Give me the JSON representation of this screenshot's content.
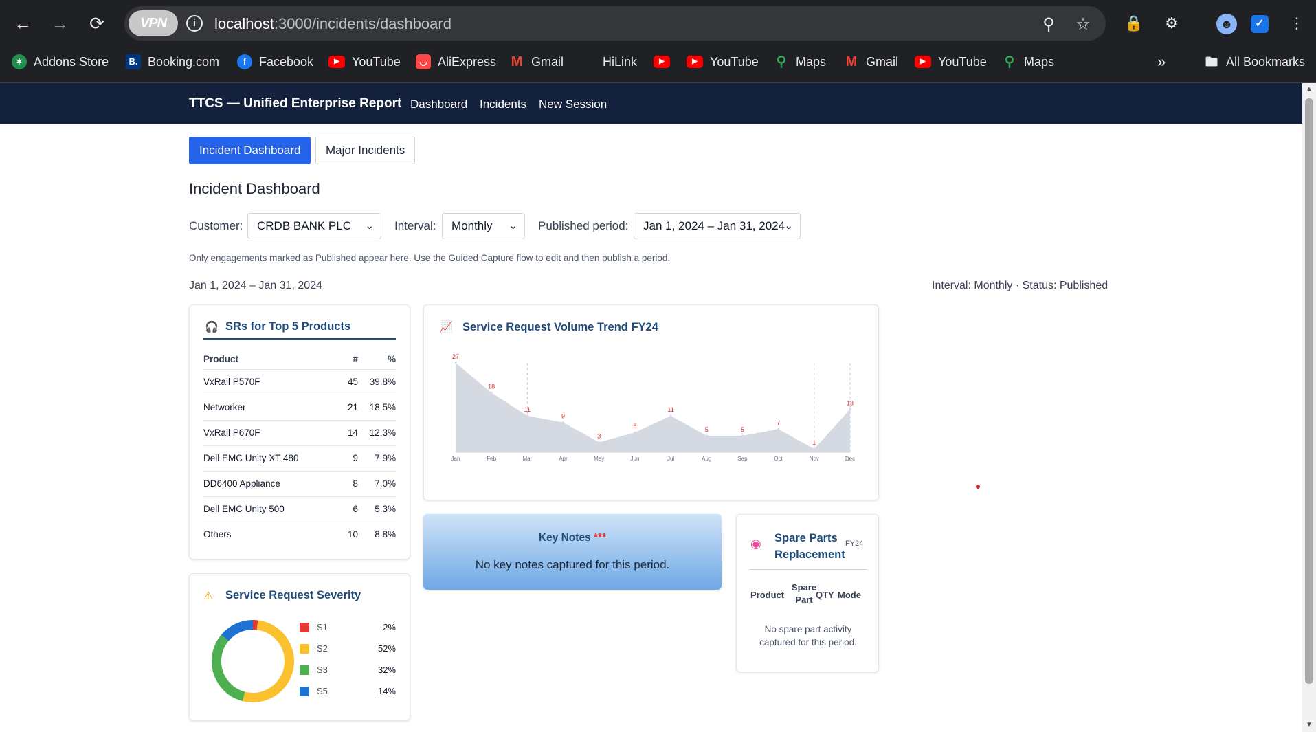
{
  "browser": {
    "url_host": "localhost",
    "url_path": ":3000/incidents/dashboard",
    "vpn_label": "VPN",
    "bookmarks": [
      {
        "label": "Addons Store",
        "icon": "addons-store-icon"
      },
      {
        "label": "Booking.com",
        "icon": "booking-icon"
      },
      {
        "label": "Facebook",
        "icon": "facebook-icon"
      },
      {
        "label": "YouTube",
        "icon": "youtube-icon"
      },
      {
        "label": "AliExpress",
        "icon": "aliexpress-icon"
      },
      {
        "label": "Gmail",
        "icon": "gmail-icon"
      },
      {
        "label": "HiLink",
        "icon": "hilink-icon"
      },
      {
        "label": "",
        "icon": "youtube-icon"
      },
      {
        "label": "YouTube",
        "icon": "youtube-icon"
      },
      {
        "label": "Maps",
        "icon": "maps-icon"
      },
      {
        "label": "Gmail",
        "icon": "gmail-icon"
      },
      {
        "label": "YouTube",
        "icon": "youtube-icon"
      },
      {
        "label": "Maps",
        "icon": "maps-icon"
      }
    ],
    "all_bookmarks": "All Bookmarks"
  },
  "app": {
    "title": "TTCS — Unified Enterprise Report",
    "nav": [
      "Dashboard",
      "Incidents",
      "New Session"
    ]
  },
  "tabs": [
    "Incident Dashboard",
    "Major Incidents"
  ],
  "heading": "Incident Dashboard",
  "filters": {
    "customer_label": "Customer:",
    "customer_value": "CRDB BANK PLC",
    "interval_label": "Interval:",
    "interval_value": "Monthly",
    "period_label": "Published period:",
    "period_value": "Jan 1, 2024 – Jan 31, 2024"
  },
  "hint": "Only engagements marked as Published appear here. Use the Guided Capture flow to edit and then publish a period.",
  "period_display": "Jan 1, 2024 – Jan 31, 2024",
  "status_display": "Interval: Monthly · Status: Published",
  "top_products": {
    "title": "SRs for Top 5 Products",
    "headers": [
      "Product",
      "#",
      "%"
    ],
    "rows": [
      [
        "VxRail P570F",
        "45",
        "39.8%"
      ],
      [
        "Networker",
        "21",
        "18.5%"
      ],
      [
        "VxRail P670F",
        "14",
        "12.3%"
      ],
      [
        "Dell EMC Unity XT 480",
        "9",
        "7.9%"
      ],
      [
        "DD6400 Appliance",
        "8",
        "7.0%"
      ],
      [
        "Dell EMC Unity 500",
        "6",
        "5.3%"
      ],
      [
        "Others",
        "10",
        "8.8%"
      ]
    ]
  },
  "trend": {
    "title": "Service Request Volume Trend FY24"
  },
  "severity": {
    "title": "Service Request Severity",
    "items": [
      {
        "name": "S1",
        "pct": "2%",
        "value": 2,
        "color": "#e53935"
      },
      {
        "name": "S2",
        "pct": "52%",
        "value": 52,
        "color": "#fbc02d"
      },
      {
        "name": "S3",
        "pct": "32%",
        "value": 32,
        "color": "#4caf50"
      },
      {
        "name": "S5",
        "pct": "14%",
        "value": 14,
        "color": "#1e73d2"
      }
    ]
  },
  "key_notes": {
    "title": "Key Notes",
    "stars": "***",
    "empty": "No key notes captured for this period."
  },
  "spare_parts": {
    "title_line1": "Spare Parts",
    "title_line2": "Replacement",
    "badge": "FY24",
    "headers": [
      "Product",
      "Spare",
      "Part",
      "QTY",
      "Mode"
    ],
    "empty_line1": "No spare part activity",
    "empty_line2": "captured for this period."
  },
  "chart_data": {
    "type": "area",
    "title": "Service Request Volume Trend FY24",
    "categories": [
      "Jan",
      "Feb",
      "Mar",
      "Apr",
      "May",
      "Jun",
      "Jul",
      "Aug",
      "Sep",
      "Oct",
      "Nov",
      "Dec"
    ],
    "values": [
      27,
      18,
      11,
      9,
      3,
      6,
      11,
      5,
      5,
      7,
      1,
      13
    ],
    "markers": [
      "Mar",
      "Nov",
      "Dec"
    ],
    "ylim": [
      0,
      27
    ],
    "fill_color": "#d5d9e2",
    "label_color": "#d32f2f"
  }
}
